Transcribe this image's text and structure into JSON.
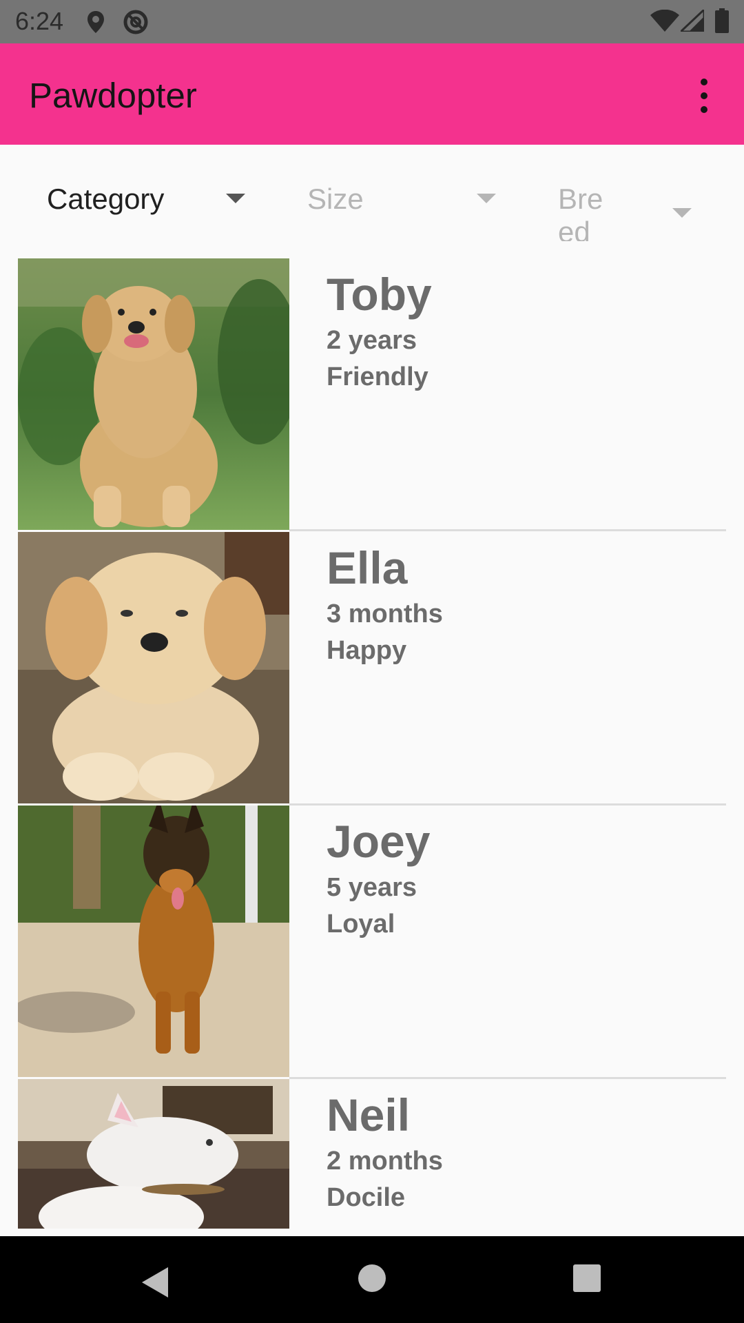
{
  "status_bar": {
    "time": "6:24",
    "icons": [
      "location-icon",
      "at-sign-icon",
      "wifi-icon",
      "signal-icon",
      "battery-icon"
    ]
  },
  "app_bar": {
    "title": "Pawdopter",
    "background_color": "#f4328e",
    "menu_icon": "more-vert-icon"
  },
  "filters": [
    {
      "label": "Category",
      "enabled": true
    },
    {
      "label": "Size",
      "enabled": false
    },
    {
      "label": "Bre\ned",
      "enabled": false
    }
  ],
  "pets": [
    {
      "name": "Toby",
      "age": "2 years",
      "trait": "Friendly",
      "photo": "golden-retriever-sitting"
    },
    {
      "name": "Ella",
      "age": "3 months",
      "trait": "Happy",
      "photo": "golden-retriever-puppy"
    },
    {
      "name": "Joey",
      "age": "5 years",
      "trait": "Loyal",
      "photo": "german-shepherd-walking"
    },
    {
      "name": "Neil",
      "age": "2 months",
      "trait": "Docile",
      "photo": "white-kitten"
    }
  ],
  "nav_bar": {
    "icons": [
      "back-icon",
      "home-icon",
      "recents-icon"
    ]
  }
}
